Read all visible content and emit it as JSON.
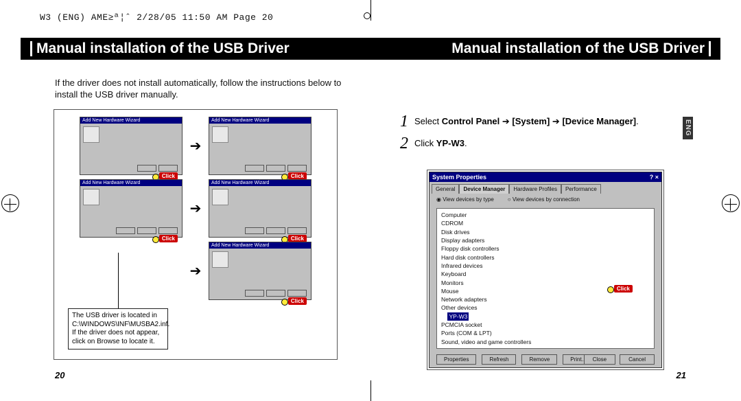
{
  "print_meta": "W3 (ENG) AME≥ª¦ˆ  2/28/05 11:50 AM  Page 20",
  "header": {
    "leftTitle": "Manual installation of the USB Driver",
    "rightTitle": "Manual installation of the USB Driver"
  },
  "langTab": "ENG",
  "leftPage": {
    "intro": "If the driver does not install automatically, follow the instructions below to install the USB driver manually.",
    "shotTitle": "Add New Hardware Wizard",
    "clickLabel": "Click",
    "arrow": "➔",
    "noteBox": "The USB driver is located in C:\\WINDOWS\\INF\\MUSBA2.inf. If the driver does not appear, click on Browse to locate it.",
    "pageNum": "20"
  },
  "rightPage": {
    "step1_pre": "Select ",
    "step1_b1": "Control Panel",
    "step1_arrow": " ➔ ",
    "step1_b2": "[System]",
    "step1_b3": "[Device Manager]",
    "step1_end": ".",
    "step2_pre": "Click ",
    "step2_b": "YP-W3",
    "step2_end": ".",
    "sys": {
      "title": "System Properties",
      "winControls": "? ×",
      "tabs": [
        "General",
        "Device Manager",
        "Hardware Profiles",
        "Performance"
      ],
      "radioA": "View devices by type",
      "radioB": "View devices by connection",
      "tree": [
        "Computer",
        "  CDROM",
        "  Disk drives",
        "  Display adapters",
        "  Floppy disk controllers",
        "  Hard disk controllers",
        "  Infrared devices",
        "  Keyboard",
        "  Monitors",
        "  Mouse",
        "  Network adapters",
        "  Other devices"
      ],
      "selected": "YP-W3",
      "afterSel": [
        "  PCMCIA socket",
        "  Ports (COM & LPT)",
        "  Sound, video and game controllers"
      ],
      "midButtons": [
        "Properties",
        "Refresh",
        "Remove",
        "Print..."
      ],
      "botButtons": [
        "Close",
        "Cancel"
      ],
      "clickLabel": "Click"
    },
    "pageNum": "21"
  }
}
